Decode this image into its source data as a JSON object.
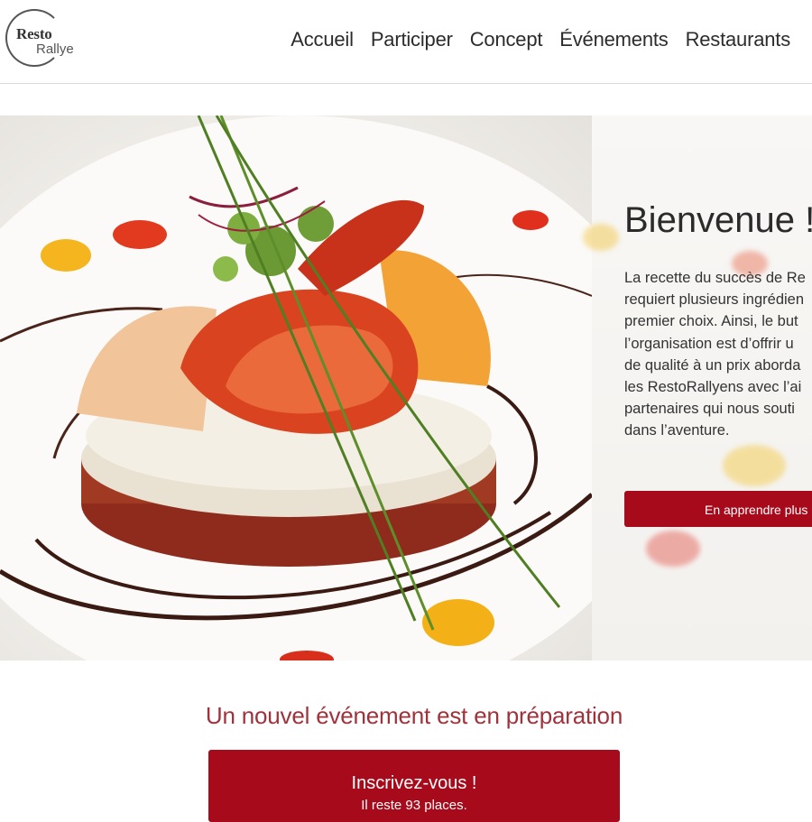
{
  "header": {
    "logo": {
      "line1": "Resto",
      "line2": "Rallye"
    },
    "nav": [
      "Accueil",
      "Participer",
      "Concept",
      "Événements",
      "Restaurants"
    ]
  },
  "hero": {
    "title": "Bienvenue !",
    "text_lines": [
      "La recette du succès de Re",
      "requiert plusieurs ingrédien",
      "premier choix. Ainsi, le but",
      "l’organisation est d’offrir u",
      "de qualité à un prix aborda",
      "les RestoRallyens avec l’ai",
      "partenaires qui nous souti",
      "dans l’aventure."
    ],
    "button_label": "En apprendre plus"
  },
  "event": {
    "title": "Un nouvel événement est en préparation",
    "signup_label": "Inscrivez-vous !",
    "signup_sub": "Il reste 93 places."
  },
  "colors": {
    "accent": "#a60a1b",
    "event_title": "#a0323c"
  }
}
